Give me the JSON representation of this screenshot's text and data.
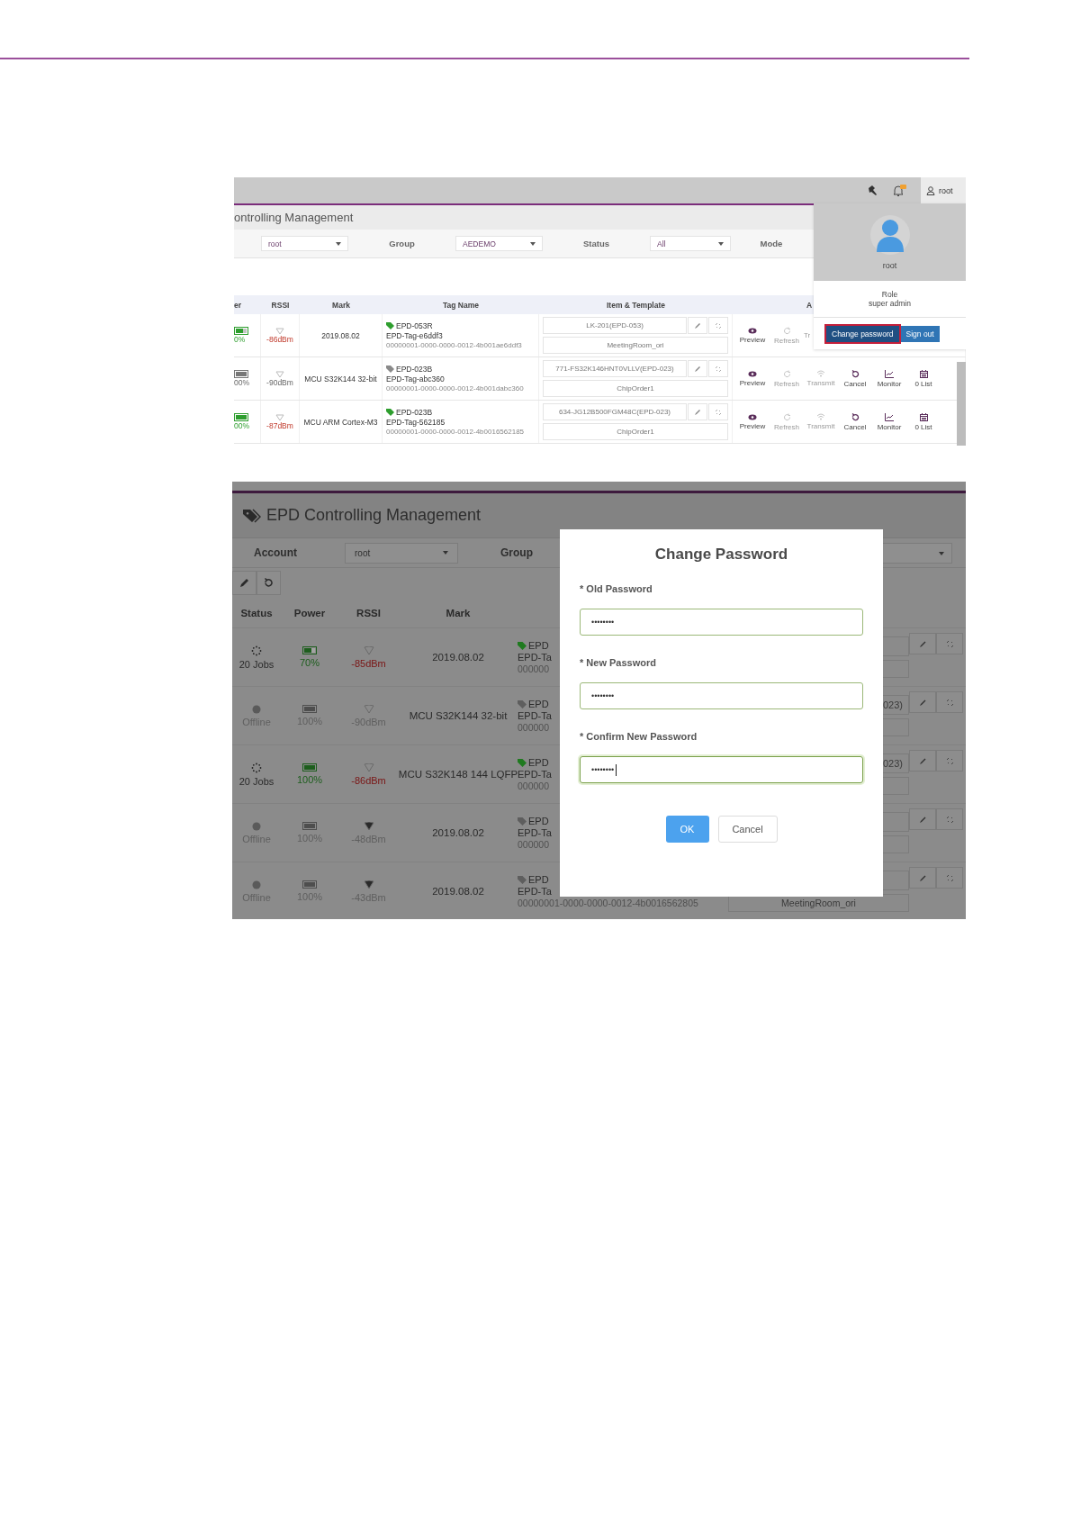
{
  "shot_1": {
    "user": "root",
    "title": "ontrolling Management",
    "filters": [
      {
        "kind": "select",
        "text": "root"
      },
      {
        "kind": "label",
        "text": "Group"
      },
      {
        "kind": "select",
        "text": "AEDEMO"
      },
      {
        "kind": "label",
        "text": "Status"
      },
      {
        "kind": "select",
        "text": "All"
      },
      {
        "kind": "label",
        "text": "Mode"
      }
    ],
    "columns": [
      "er",
      "RSSI",
      "Mark",
      "Tag Name",
      "Item & Template",
      "A"
    ],
    "rows": [
      {
        "power": "0%",
        "level": 0.7,
        "online": true,
        "rssi": "-86dBm",
        "mark": "2019.08.02",
        "tag": {
          "color": "#2e9e2e",
          "code": "EPD-053R",
          "name": "EPD-Tag-e6ddf3",
          "id": "00000001-0000-0000-0012-4b001ae6ddf3"
        },
        "item": "LK-201(EPD-053)",
        "template": "MeetingRoom_ori",
        "actions": [
          {
            "kind": "preview",
            "label": "Preview",
            "disabled": false
          },
          {
            "kind": "refresh",
            "label": "Refresh",
            "disabled": true
          },
          {
            "kind": "cut",
            "label": "Tr",
            "disabled": true
          }
        ]
      },
      {
        "power": "00%",
        "level": 1,
        "online": false,
        "rssi": "-90dBm",
        "mark": "MCU S32K144 32-bit",
        "tag": {
          "color": "#8a8a8a",
          "code": "EPD-023B",
          "name": "EPD-Tag-abc360",
          "id": "00000001-0000-0000-0012-4b001dabc360"
        },
        "item": "771-FS32K146HNT0VLLV(EPD-023)",
        "template": "ChipOrder1",
        "actions": [
          {
            "kind": "preview",
            "label": "Preview",
            "disabled": false
          },
          {
            "kind": "refresh",
            "label": "Refresh",
            "disabled": true
          },
          {
            "kind": "transmit",
            "label": "Transmit",
            "disabled": true
          },
          {
            "kind": "cancel",
            "label": "Cancel",
            "disabled": false
          },
          {
            "kind": "monitor",
            "label": "Monitor",
            "disabled": false
          },
          {
            "kind": "list",
            "label": "0 List",
            "disabled": false
          }
        ]
      },
      {
        "power": "00%",
        "level": 1,
        "online": true,
        "rssi": "-87dBm",
        "mark": "MCU ARM Cortex-M3",
        "tag": {
          "color": "#2e9e2e",
          "code": "EPD-023B",
          "name": "EPD-Tag-562185",
          "id": "00000001-0000-0000-0012-4b0016562185"
        },
        "item": "634-JG12B500FGM48C(EPD-023)",
        "template": "ChipOrder1",
        "actions": [
          {
            "kind": "preview",
            "label": "Preview",
            "disabled": false
          },
          {
            "kind": "refresh",
            "label": "Refresh",
            "disabled": true
          },
          {
            "kind": "transmit",
            "label": "Transmit",
            "disabled": true
          },
          {
            "kind": "cancel",
            "label": "Cancel",
            "disabled": false
          },
          {
            "kind": "monitor",
            "label": "Monitor",
            "disabled": false
          },
          {
            "kind": "list",
            "label": "0 List",
            "disabled": false
          }
        ]
      }
    ],
    "user_panel": {
      "name": "root",
      "role_label": "Role",
      "role": "super admin",
      "buttons": [
        {
          "label": "Change password",
          "highlighted": true
        },
        {
          "label": "Sign out",
          "highlighted": false
        }
      ]
    }
  },
  "shot_2": {
    "title": "EPD Controlling Management",
    "filters": [
      {
        "kind": "label",
        "text": "Account"
      },
      {
        "kind": "select",
        "text": "root"
      },
      {
        "kind": "label",
        "text": "Group"
      }
    ],
    "columns": [
      "Status",
      "Power",
      "RSSI",
      "Mark"
    ],
    "rows": [
      {
        "status": {
          "kind": "busy",
          "text": "20 Jobs"
        },
        "power": "70%",
        "level": 0.7,
        "online": true,
        "rssi": "-85dBm",
        "rssi_icon_filled": false,
        "mark": "2019.08.02",
        "tag": {
          "color": "#1f7a1f",
          "code": "EPD",
          "name": "EPD-Ta",
          "id": "000000"
        }
      },
      {
        "status": {
          "kind": "offline",
          "text": "Offline"
        },
        "power": "100%",
        "level": 1,
        "online": false,
        "rssi": "-90dBm",
        "rssi_icon_filled": false,
        "mark": "MCU S32K144 32-bit",
        "tag": {
          "color": "#5e5e5e",
          "code": "EPD",
          "name": "EPD-Ta",
          "id": "000000"
        },
        "item": "023)"
      },
      {
        "status": {
          "kind": "busy",
          "text": "20 Jobs"
        },
        "power": "100%",
        "level": 1,
        "online": true,
        "rssi": "-86dBm",
        "rssi_icon_filled": false,
        "mark": "MCU S32K148 144 LQFP",
        "tag": {
          "color": "#1f7a1f",
          "code": "EPD",
          "name": "EPD-Ta",
          "id": "000000"
        },
        "item": "023)"
      },
      {
        "status": {
          "kind": "offline",
          "text": "Offline"
        },
        "power": "100%",
        "level": 1,
        "online": false,
        "rssi": "-48dBm",
        "rssi_icon_filled": true,
        "mark": "2019.08.02",
        "tag": {
          "color": "#5e5e5e",
          "code": "EPD",
          "name": "EPD-Ta",
          "id": "000000"
        }
      },
      {
        "status": {
          "kind": "offline",
          "text": "Offline"
        },
        "power": "100%",
        "level": 1,
        "online": false,
        "rssi": "-43dBm",
        "rssi_icon_filled": true,
        "mark": "2019.08.02",
        "tag": {
          "color": "#5e5e5e",
          "code": "EPD",
          "name": "EPD-Ta",
          "id": "00000001-0000-0000-0012-4b0016562805"
        },
        "template": "MeetingRoom_ori"
      }
    ],
    "modal": {
      "title": "Change Password",
      "fields": [
        {
          "label": "* Old Password",
          "value": "••••••••",
          "focused": false
        },
        {
          "label": "* New Password",
          "value": "••••••••",
          "focused": false
        },
        {
          "label": "* Confirm New Password",
          "value": "••••••••",
          "focused": true
        }
      ],
      "buttons": [
        {
          "label": "OK",
          "primary": true
        },
        {
          "label": "Cancel",
          "primary": false
        }
      ]
    }
  }
}
